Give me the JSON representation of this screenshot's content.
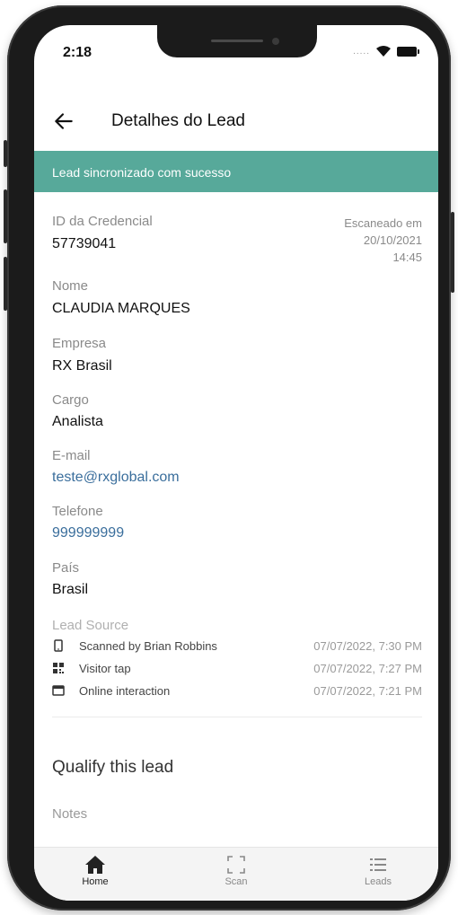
{
  "status": {
    "time": "2:18",
    "dots": "....."
  },
  "header": {
    "title": "Detalhes do Lead"
  },
  "banner": {
    "message": "Lead sincronizado com sucesso"
  },
  "fields": {
    "credential": {
      "label": "ID da Credencial",
      "value": "57739041"
    },
    "scanned": {
      "label": "Escaneado em",
      "date": "20/10/2021",
      "time": "14:45"
    },
    "name": {
      "label": "Nome",
      "value": "CLAUDIA MARQUES"
    },
    "company": {
      "label": "Empresa",
      "value": "RX Brasil"
    },
    "role": {
      "label": "Cargo",
      "value": "Analista"
    },
    "email": {
      "label": "E-mail",
      "value": "teste@rxglobal.com"
    },
    "phone": {
      "label": "Telefone",
      "value": "999999999"
    },
    "country": {
      "label": "País",
      "value": "Brasil"
    }
  },
  "lead_source": {
    "label": "Lead Source",
    "items": [
      {
        "icon": "mobile-phone-icon",
        "name": "Scanned by Brian Robbins",
        "date": "07/07/2022, 7:30 PM"
      },
      {
        "icon": "qr-code-icon",
        "name": "Visitor tap",
        "date": "07/07/2022, 7:27 PM"
      },
      {
        "icon": "browser-window-icon",
        "name": "Online interaction",
        "date": "07/07/2022, 7:21 PM"
      }
    ]
  },
  "qualify": {
    "title": "Qualify this lead",
    "notes_label": "Notes"
  },
  "nav": {
    "home": {
      "label": "Home",
      "icon": "home-icon"
    },
    "scan": {
      "label": "Scan",
      "icon": "scan-frame-icon"
    },
    "leads": {
      "label": "Leads",
      "icon": "list-icon"
    }
  },
  "colors": {
    "banner": "#57a99a",
    "link": "#3a6e9c",
    "label": "#8a8a8a"
  }
}
